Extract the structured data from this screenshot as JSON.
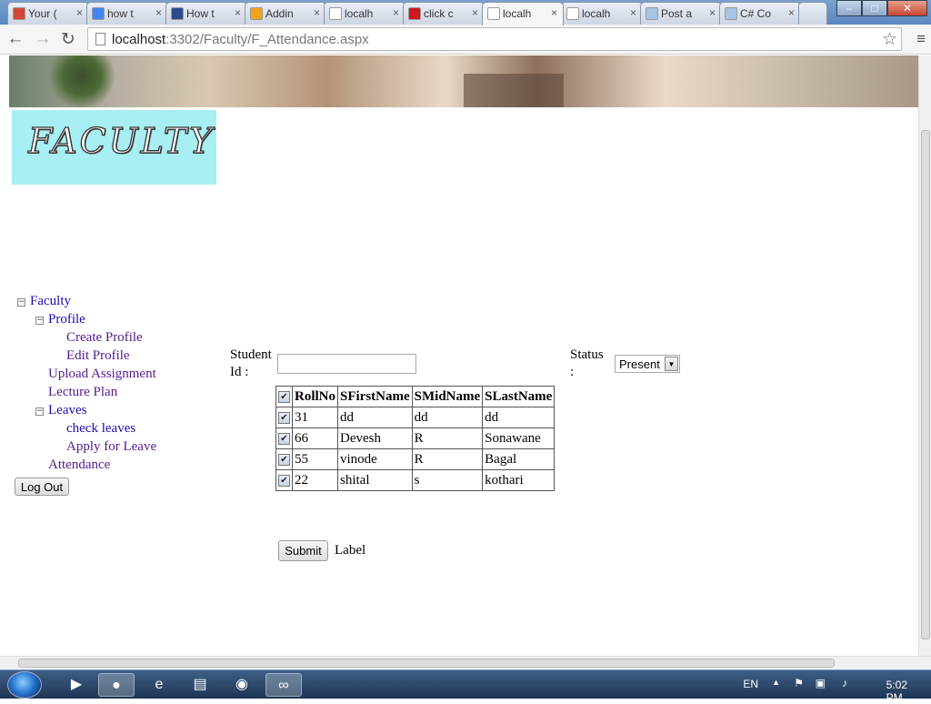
{
  "browser": {
    "tabs": [
      {
        "label": "Your (",
        "favicon_color": "#d44638"
      },
      {
        "label": "how t",
        "favicon_color": "#4285f4"
      },
      {
        "label": "How t",
        "favicon_color": "#2b4a8a"
      },
      {
        "label": "Addin",
        "favicon_color": "#f2a31a"
      },
      {
        "label": "localh",
        "favicon_color": "#ffffff"
      },
      {
        "label": "click c",
        "favicon_color": "#cc181e"
      },
      {
        "label": "localh",
        "favicon_color": "#ffffff"
      },
      {
        "label": "localh",
        "favicon_color": "#ffffff"
      },
      {
        "label": "Post a",
        "favicon_color": "#a5c4e6"
      },
      {
        "label": "C# Co",
        "favicon_color": "#a5c4e6"
      }
    ],
    "active_tab_index": 6,
    "url_host": "localhost",
    "url_path": ":3302/Faculty/F_Attendance.aspx"
  },
  "page": {
    "logo_text": "FACULTY",
    "tree": {
      "root": "Faculty",
      "profile": "Profile",
      "create_profile": "Create Profile",
      "edit_profile": "Edit Profile",
      "upload_assignment": "Upload Assignment",
      "lecture_plan": "Lecture Plan",
      "leaves": "Leaves",
      "check_leaves": "check leaves",
      "apply_leave": "Apply for Leave",
      "attendance": "Attendance"
    },
    "logout_label": "Log Out",
    "student_id_label_1": "Student",
    "student_id_label_2": "Id :",
    "student_id_value": "",
    "status_label_1": "Status",
    "status_label_2": ":",
    "status_value": "Present",
    "grid": {
      "headers": [
        "RollNo",
        "SFirstName",
        "SMidName",
        "SLastName"
      ],
      "rows": [
        {
          "roll": "31",
          "first": "dd",
          "mid": "dd",
          "last": "dd",
          "checked": true
        },
        {
          "roll": "66",
          "first": "Devesh",
          "mid": "R",
          "last": "Sonawane",
          "checked": true
        },
        {
          "roll": "55",
          "first": "vinode",
          "mid": "R",
          "last": "Bagal",
          "checked": true
        },
        {
          "roll": "22",
          "first": "shital",
          "mid": "s",
          "last": "kothari",
          "checked": true
        }
      ]
    },
    "submit_label": "Submit",
    "result_label": "Label"
  },
  "taskbar": {
    "language": "EN",
    "clock": "5:02 PM"
  }
}
